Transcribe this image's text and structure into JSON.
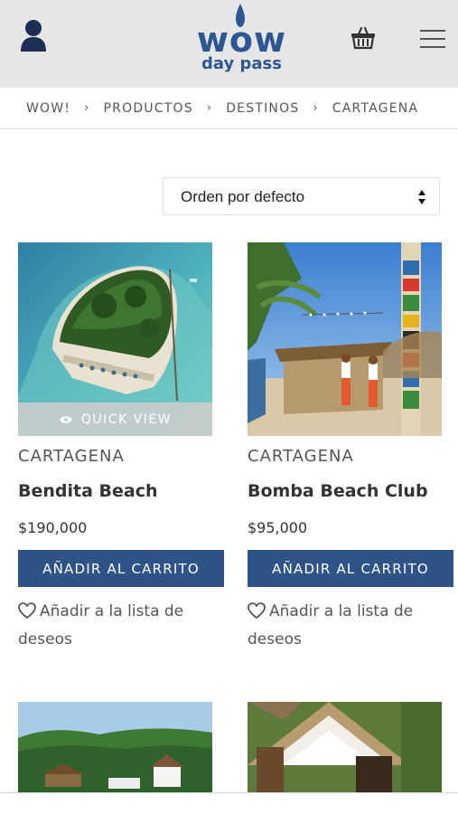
{
  "header": {
    "logo_top": "wow",
    "logo_bottom": "day pass",
    "brand_color": "#2d5692",
    "icons": [
      "user-icon",
      "cart-icon",
      "menu-icon"
    ]
  },
  "breadcrumb": [
    "WOW!",
    "PRODUCTOS",
    "DESTINOS",
    "CARTAGENA"
  ],
  "sort": {
    "selected": "Orden por defecto"
  },
  "products": [
    {
      "category": "CARTAGENA",
      "title": "Bendita Beach",
      "price": "$190,000",
      "quick_view": "QUICK VIEW",
      "add_to_cart": "AÑADIR AL CARRITO",
      "wishlist": "Añadir a la lista de deseos"
    },
    {
      "category": "CARTAGENA",
      "title": "Bomba Beach Club",
      "price": "$95,000",
      "add_to_cart": "AÑADIR AL CARRITO",
      "wishlist": "Añadir a la lista de deseos"
    }
  ],
  "colors": {
    "button": "#2e5387",
    "header_bg": "#e6e6e6"
  }
}
